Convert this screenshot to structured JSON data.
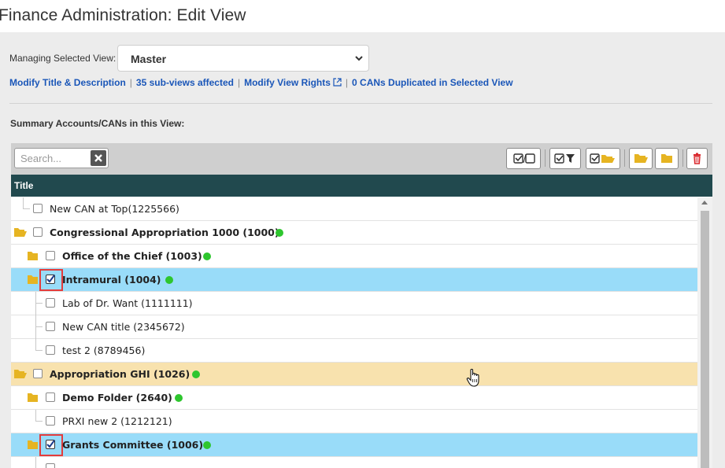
{
  "page": {
    "title": "Finance Administration: Edit View"
  },
  "managing": {
    "label": "Managing Selected View:",
    "selected_value": "Master",
    "options": [
      "Master"
    ]
  },
  "links": {
    "modify_title": "Modify Title & Description",
    "sub_views": "35 sub-views affected",
    "modify_rights": "Modify View Rights",
    "cans_duplicated": "0 CANs Duplicated in Selected View"
  },
  "section": {
    "label": "Summary Accounts/CANs in this View:"
  },
  "search": {
    "placeholder": "Search...",
    "value": ""
  },
  "table": {
    "header_title": "Title"
  },
  "icons": {
    "folder": "folder-icon",
    "open_folder": "folder-open-icon",
    "check": "checkbox-checked-icon",
    "status": "status-green-dot-icon",
    "search_clear": "close-icon",
    "delete": "trash-icon"
  },
  "colors": {
    "header_bg": "#21494e",
    "link": "#1a56b8",
    "selected_row": "#99dcf9",
    "hover_row": "#f8e2ae",
    "status_green": "#2ec62e",
    "folder": "#e6b422",
    "delete": "#d9262b",
    "highlight": "#e33c3c"
  },
  "rows": [
    {
      "label": "New CAN at Top(1225566)",
      "checked": false
    },
    {
      "label": "Congressional Appropriation 1000 (1000)",
      "checked": false
    },
    {
      "label": "Office of the Chief (1003)",
      "checked": false
    },
    {
      "label": "Intramural (1004)",
      "checked": true
    },
    {
      "label": "Lab of Dr. Want (1111111)",
      "checked": false
    },
    {
      "label": "New CAN title (2345672)",
      "checked": false
    },
    {
      "label": "test 2 (8789456)",
      "checked": false
    },
    {
      "label": "Appropriation GHI (1026)",
      "checked": false
    },
    {
      "label": "Demo Folder (2640)",
      "checked": false
    },
    {
      "label": "PRXI new 2 (1212121)",
      "checked": false
    },
    {
      "label": "Grants Committee (1006)",
      "checked": true
    }
  ]
}
